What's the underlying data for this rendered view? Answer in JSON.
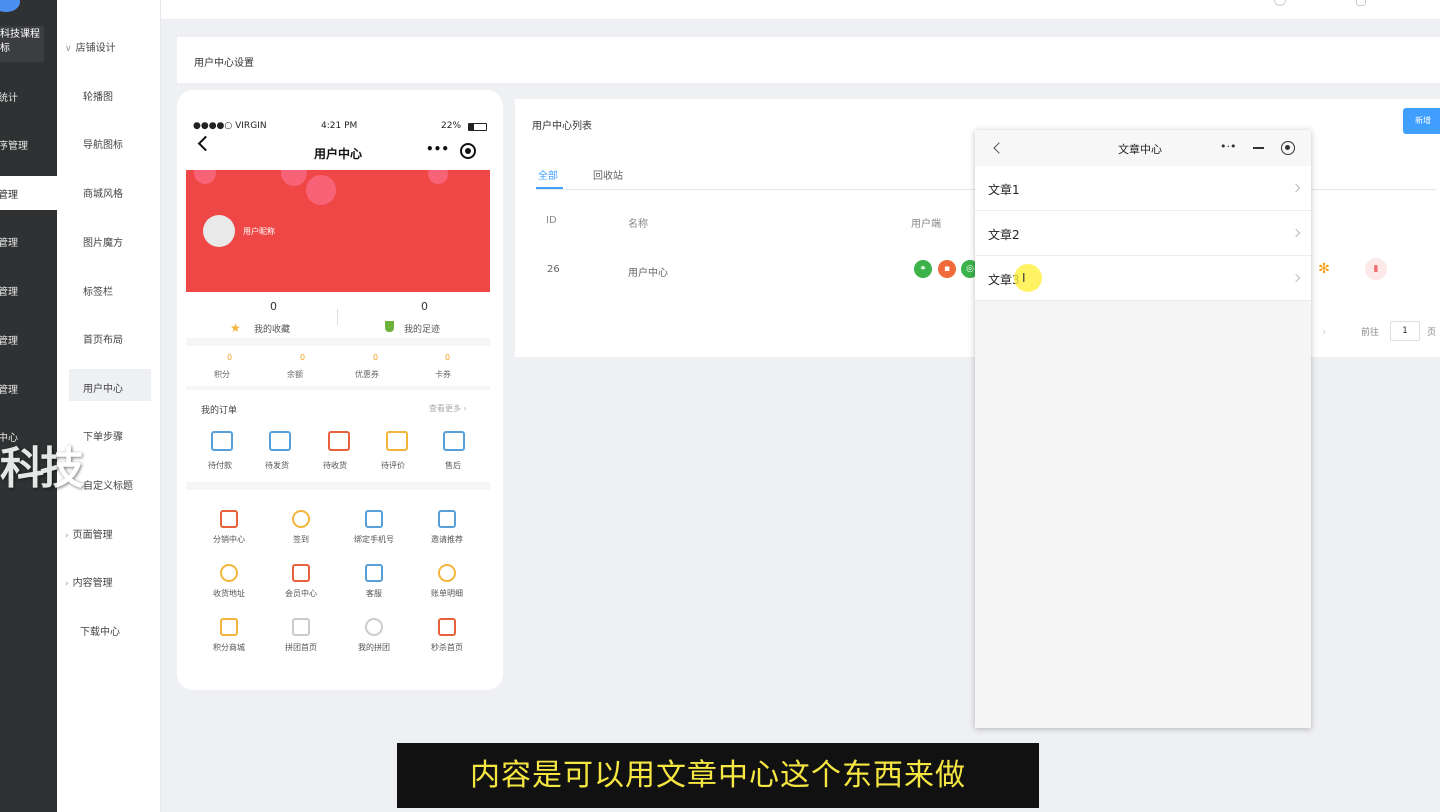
{
  "dark_sidebar": {
    "brand": "科技课程",
    "brand_sub": "标",
    "items": [
      "统计",
      "序管理",
      "管理",
      "管理",
      "管理",
      "管理",
      "管理",
      "中心"
    ],
    "active_label": "管理"
  },
  "watermark": "科技",
  "menu": {
    "group_store": "店铺设计",
    "items": [
      "轮播图",
      "导航图标",
      "商城风格",
      "图片魔方",
      "标签栏",
      "首页布局",
      "用户中心",
      "下单步骤",
      "自定义标题"
    ],
    "group_page": "页面管理",
    "group_content": "内容管理",
    "download": "下载中心"
  },
  "page_title": "用户中心设置",
  "phone": {
    "carrier": "●●●●○ VIRGIN",
    "time": "4:21 PM",
    "battery": "22%",
    "title": "用户中心",
    "more_icon": "•••",
    "username": "用户昵称",
    "favorites_count": "0",
    "favorites_label": "我的收藏",
    "footprint_count": "0",
    "footprint_label": "我的足迹",
    "assets": [
      {
        "num": "0",
        "label": "积分"
      },
      {
        "num": "0",
        "label": "余额"
      },
      {
        "num": "0",
        "label": "优惠券"
      },
      {
        "num": "0",
        "label": "卡券"
      }
    ],
    "orders_title": "我的订单",
    "orders_more": "查看更多 ›",
    "order_items": [
      "待付款",
      "待发货",
      "待收货",
      "待评价",
      "售后"
    ],
    "grid": [
      {
        "label": "分销中心",
        "icon": "sitemap-icon",
        "color": "#e8603c"
      },
      {
        "label": "签到",
        "icon": "coin-icon",
        "color": "#f3b43c"
      },
      {
        "label": "绑定手机号",
        "icon": "phone-icon",
        "color": "#5aa0d8"
      },
      {
        "label": "邀请推荐",
        "icon": "share-icon",
        "color": "#5aa0d8"
      },
      {
        "label": "收货地址",
        "icon": "location-icon",
        "color": "#f3b43c"
      },
      {
        "label": "会员中心",
        "icon": "crown-icon",
        "color": "#e8603c"
      },
      {
        "label": "客服",
        "icon": "headset-icon",
        "color": "#5aa0d8"
      },
      {
        "label": "账单明细",
        "icon": "bill-icon",
        "color": "#f3b43c"
      },
      {
        "label": "积分商城",
        "icon": "gift-icon",
        "color": "#f3b43c"
      },
      {
        "label": "拼团首页",
        "icon": "group-icon",
        "color": "#cccccc"
      },
      {
        "label": "我的拼团",
        "icon": "group-icon",
        "color": "#cccccc"
      },
      {
        "label": "秒杀首页",
        "icon": "alarm-icon",
        "color": "#e8603c"
      }
    ]
  },
  "list": {
    "title": "用户中心列表",
    "new_button": "新增",
    "tabs": [
      "全部",
      "回收站"
    ],
    "columns": {
      "id": "ID",
      "name": "名称",
      "client": "用户端"
    },
    "rows": [
      {
        "id": "26",
        "name": "用户中心"
      }
    ],
    "pager_goto": "前往",
    "pager_page": "1",
    "pager_unit": "页"
  },
  "popup": {
    "title": "文章中心",
    "items": [
      "文章1",
      "文章2",
      "文章3"
    ]
  },
  "subtitle": "内容是可以用文章中心这个东西来做",
  "colors": {
    "accent": "#409eff",
    "banner": "#ee4746",
    "subtitle_text": "#f5e642"
  }
}
